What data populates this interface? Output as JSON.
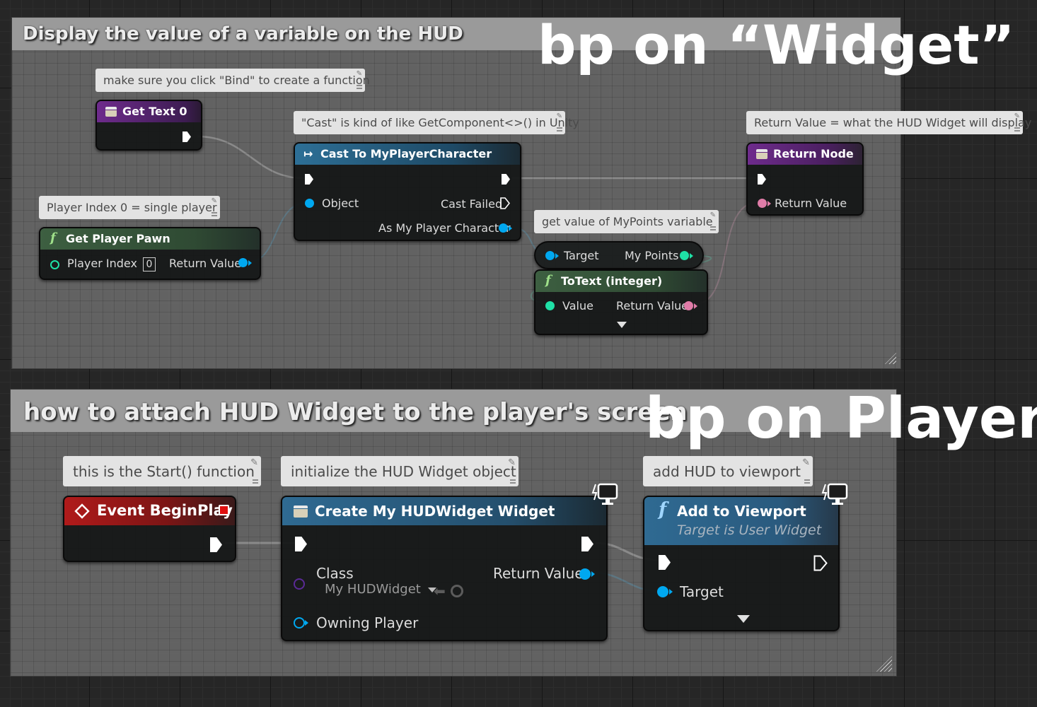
{
  "colors": {
    "exec_wire": "#ffffff",
    "object_pin": "#00a8f0",
    "int_pin": "#1fe0a6",
    "text_pin": "#e07ca8",
    "class_pin": "#5a2a96",
    "function_header_green": "#3c5a3f",
    "pure_header_blue": "#2f6a92",
    "event_header_red": "#a51919",
    "purple_header": "#6a2a8a"
  },
  "top": {
    "comment_title": "Display the value of a variable on the HUD",
    "big_label": "bp on “Widget”",
    "bubbles": {
      "bind": "make sure you click \"Bind\" to create a function",
      "cast": "\"Cast\" is kind of like GetComponent<>() in Unity",
      "return_value": "Return Value = what the HUD Widget will display",
      "player_index": "Player Index 0 = single player",
      "my_points": "get value of MyPoints variable"
    },
    "get_text_node": {
      "title": "Get Text 0",
      "icon": "function-entry-icon"
    },
    "cast_node": {
      "title": "Cast To MyPlayerCharacter",
      "icon": "cast-arrow-icon",
      "object_pin": "Object",
      "cast_failed_pin": "Cast Failed",
      "as_pin": "As My Player Character"
    },
    "return_node": {
      "title": "Return Node",
      "icon": "function-entry-icon",
      "return_pin": "Return Value"
    },
    "get_player_pawn": {
      "title": "Get Player Pawn",
      "icon": "function-f-icon",
      "index_label": "Player Index",
      "index_value": "0",
      "return_pin": "Return Value"
    },
    "mypoints_node": {
      "target_pin": "Target",
      "out_pin": "My Points"
    },
    "totext_node": {
      "title": "ToText (integer)",
      "icon": "function-f-icon",
      "value_pin": "Value",
      "return_pin": "Return Value"
    }
  },
  "bottom": {
    "comment_title": "how to attach HUD Widget to the player's screen",
    "big_label": "bp on Player",
    "bubbles": {
      "start": "this is the Start() function",
      "init": "initialize the HUD Widget object",
      "viewport": "add HUD to viewport"
    },
    "begin_play": {
      "title": "Event BeginPlay",
      "icon": "event-diamond-icon"
    },
    "create_widget": {
      "title": "Create My HUDWidget Widget",
      "icon": "function-entry-icon",
      "class_label": "Class",
      "class_value": "My HUDWidget",
      "return_pin": "Return Value",
      "owning_pin": "Owning Player"
    },
    "add_viewport": {
      "title": "Add to Viewport",
      "subtitle": "Target is User Widget",
      "icon": "function-f-icon",
      "target_pin": "Target"
    }
  }
}
